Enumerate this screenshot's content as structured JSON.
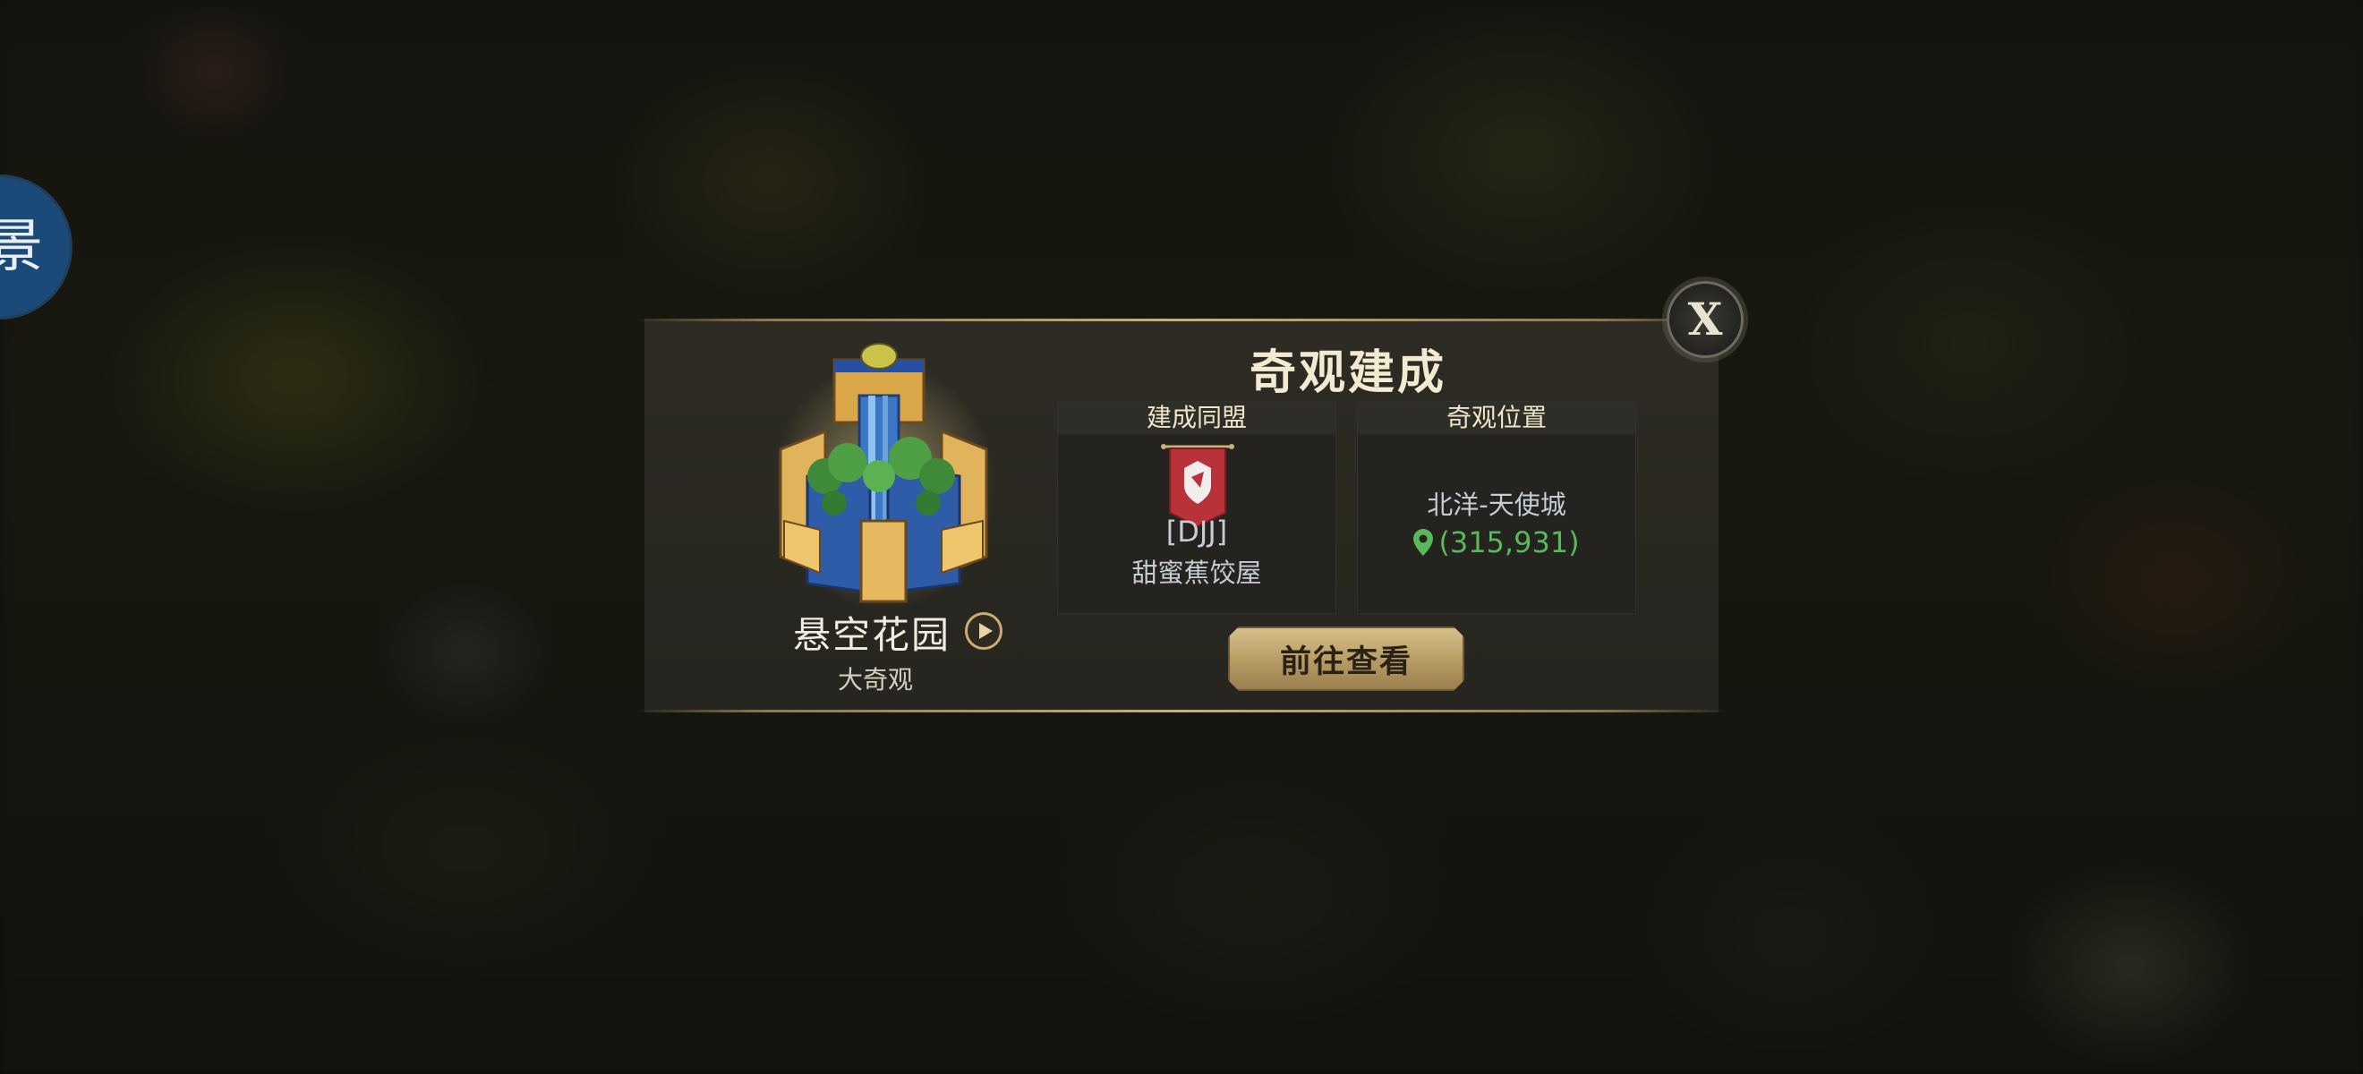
{
  "side_button": {
    "glyph": "景",
    "icon": "scenery-icon"
  },
  "panel": {
    "title": "奇观建成",
    "close_label": "X",
    "wonder": {
      "name": "悬空花园",
      "type": "大奇观",
      "icon": "hanging-gardens-icon",
      "play_icon": "play-icon"
    },
    "alliance": {
      "header": "建成同盟",
      "tag": "[DJJ]",
      "name": "甜蜜蕉饺屋",
      "icon": "alliance-banner-icon"
    },
    "location": {
      "header": "奇观位置",
      "name": "北洋-天使城",
      "coord": "(315,931)",
      "icon": "location-pin-icon"
    },
    "go_button": "前往查看"
  },
  "colors": {
    "accent_gold": "#c9ad72",
    "coord_green": "#58b85a",
    "banner_red": "#b8323a",
    "side_blue": "#1c4a78"
  }
}
